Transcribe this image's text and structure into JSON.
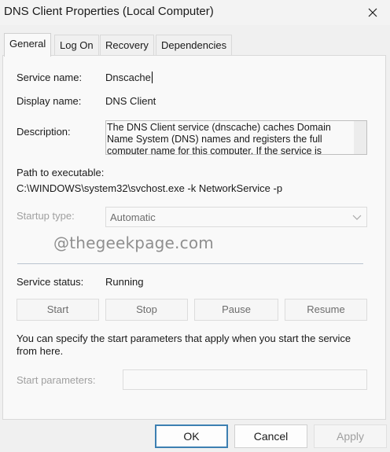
{
  "window": {
    "title": "DNS Client Properties (Local Computer)",
    "close_icon": "close-icon"
  },
  "tabs": [
    {
      "label": "General",
      "active": true
    },
    {
      "label": "Log On",
      "active": false
    },
    {
      "label": "Recovery",
      "active": false
    },
    {
      "label": "Dependencies",
      "active": false
    }
  ],
  "general": {
    "service_name_label": "Service name:",
    "service_name_value": "Dnscache",
    "display_name_label": "Display name:",
    "display_name_value": "DNS Client",
    "description_label": "Description:",
    "description_value": "The DNS Client service (dnscache) caches Domain Name System (DNS) names and registers the full computer name for this computer. If the service is",
    "path_label": "Path to executable:",
    "path_value": "C:\\WINDOWS\\system32\\svchost.exe -k NetworkService -p",
    "startup_type_label": "Startup type:",
    "startup_type_value": "Automatic",
    "watermark": "@thegeekpage.com",
    "service_status_label": "Service status:",
    "service_status_value": "Running",
    "start_label": "Start",
    "stop_label": "Stop",
    "pause_label": "Pause",
    "resume_label": "Resume",
    "info_text": "You can specify the start parameters that apply when you start the service from here.",
    "start_params_label": "Start parameters:",
    "start_params_value": ""
  },
  "dialog_buttons": {
    "ok": "OK",
    "cancel": "Cancel",
    "apply": "Apply"
  },
  "colors": {
    "default_button_border": "#3c7fb1",
    "disabled_text": "#a0a0a0"
  }
}
